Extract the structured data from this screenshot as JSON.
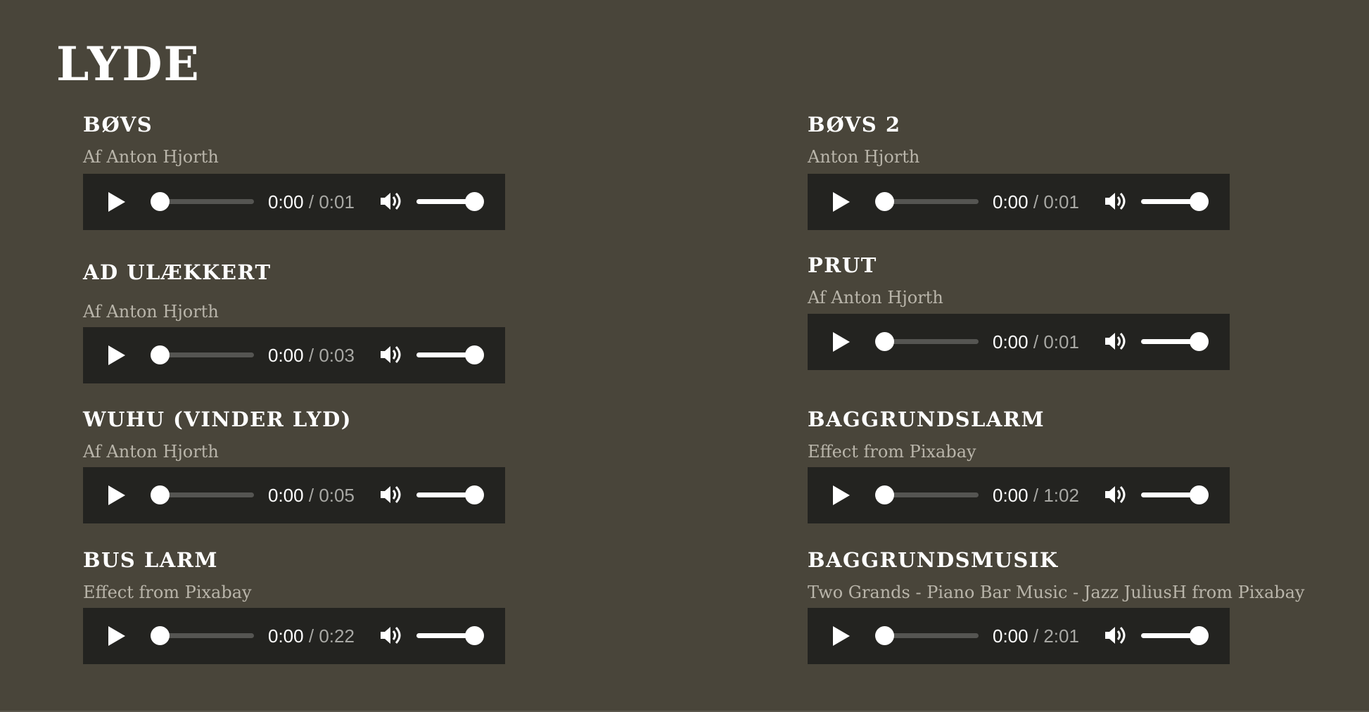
{
  "page": {
    "title": "LYDE"
  },
  "sounds": [
    {
      "title": "BØVS",
      "credit": "Af Anton Hjorth",
      "current": "0:00",
      "separator": "/",
      "duration": "0:01",
      "volume": 1.0
    },
    {
      "title": "AD ULÆKKERT",
      "credit": "Af Anton Hjorth",
      "current": "0:00",
      "separator": "/",
      "duration": "0:03",
      "volume": 1.0
    },
    {
      "title": "WUHU (VINDER LYD)",
      "credit": "Af Anton Hjorth",
      "current": "0:00",
      "separator": "/",
      "duration": "0:05",
      "volume": 1.0
    },
    {
      "title": "BUS LARM",
      "credit": "Effect from Pixabay",
      "current": "0:00",
      "separator": "/",
      "duration": "0:22",
      "volume": 1.0
    },
    {
      "title": "BØVS 2",
      "credit": "Anton Hjorth",
      "current": "0:00",
      "separator": "/",
      "duration": "0:01",
      "volume": 1.0
    },
    {
      "title": "PRUT",
      "credit": "Af Anton Hjorth",
      "current": "0:00",
      "separator": "/",
      "duration": "0:01",
      "volume": 1.0
    },
    {
      "title": "BAGGRUNDSLARM",
      "credit": "Effect from Pixabay",
      "current": "0:00",
      "separator": "/",
      "duration": "1:02",
      "volume": 1.0
    },
    {
      "title": "BAGGRUNDSMUSIK",
      "credit": "Two Grands - Piano Bar Music - Jazz JuliusH from Pixabay",
      "current": "0:00",
      "separator": "/",
      "duration": "2:01",
      "volume": 1.0
    }
  ],
  "icons": {
    "play": "play-icon",
    "volume": "volume-icon"
  },
  "colors": {
    "background": "#49453a",
    "player": "#232320",
    "text": "#ffffff",
    "credit": "#b9b5aa"
  }
}
